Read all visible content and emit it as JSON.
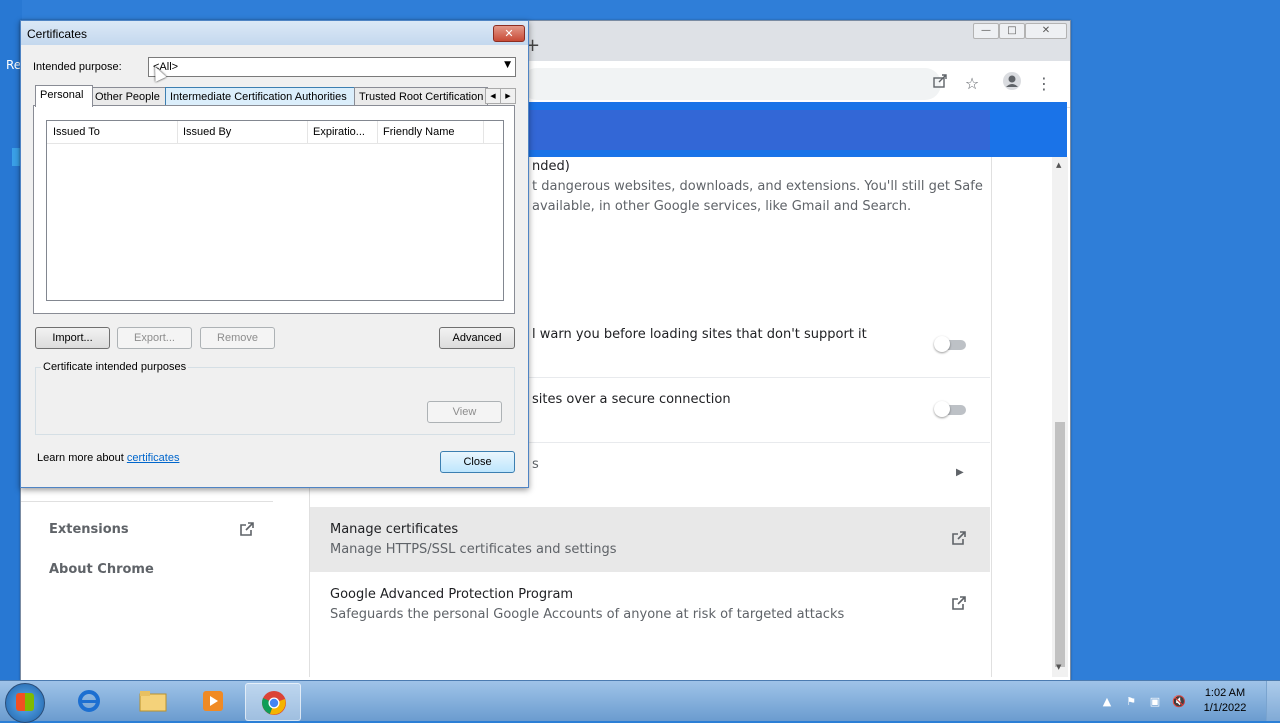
{
  "desktop": {
    "fragment_re": "Re"
  },
  "chrome": {
    "window_controls": {
      "minimize": "—",
      "maximize": "□",
      "close": "✕"
    },
    "new_tab": "+",
    "toolbar_icons": [
      "share-icon",
      "star-icon",
      "profile-icon",
      "menu-icon"
    ],
    "sidebar": {
      "items": [
        {
          "label": "Extensions"
        },
        {
          "label": "About Chrome"
        }
      ]
    },
    "content": {
      "safe_browsing_fragment_title": "nded)",
      "safe_browsing_fragment_line1": "t dangerous websites, downloads, and extensions. You'll still get Safe",
      "safe_browsing_fragment_line2": "available, in other Google services, like Gmail and Search.",
      "https_fragment": "l warn you before loading sites that don't support it",
      "secure_dns_fragment": "sites over a secure connection",
      "row3_fragment": "s",
      "manage_certificates_title": "Manage certificates",
      "manage_certificates_desc": "Manage HTTPS/SSL certificates and settings",
      "advanced_protection_title": "Google Advanced Protection Program",
      "advanced_protection_desc": "Safeguards the personal Google Accounts of anyone at risk of targeted attacks"
    }
  },
  "dialog": {
    "title": "Certificates",
    "close": "✕",
    "intended_purpose_label": "Intended purpose:",
    "intended_purpose_value": "<All>",
    "tabs": [
      {
        "label": "Personal"
      },
      {
        "label": "Other People"
      },
      {
        "label": "Intermediate Certification Authorities"
      },
      {
        "label": "Trusted Root Certification"
      }
    ],
    "columns": [
      "Issued To",
      "Issued By",
      "Expiratio...",
      "Friendly Name"
    ],
    "buttons": {
      "import": "Import...",
      "export": "Export...",
      "remove": "Remove",
      "advanced": "Advanced",
      "view": "View",
      "close": "Close"
    },
    "group_label": "Certificate intended purposes",
    "learn_more_prefix": "Learn more about ",
    "learn_more_link": "certificates"
  },
  "taskbar": {
    "apps": [
      "internet-explorer-icon",
      "file-explorer-icon",
      "media-player-icon",
      "chrome-icon"
    ],
    "clock": {
      "time": "1:02 AM",
      "date": "1/1/2022"
    }
  },
  "colors": {
    "chrome_blue": "#1a73e8",
    "link": "#0066cc"
  }
}
